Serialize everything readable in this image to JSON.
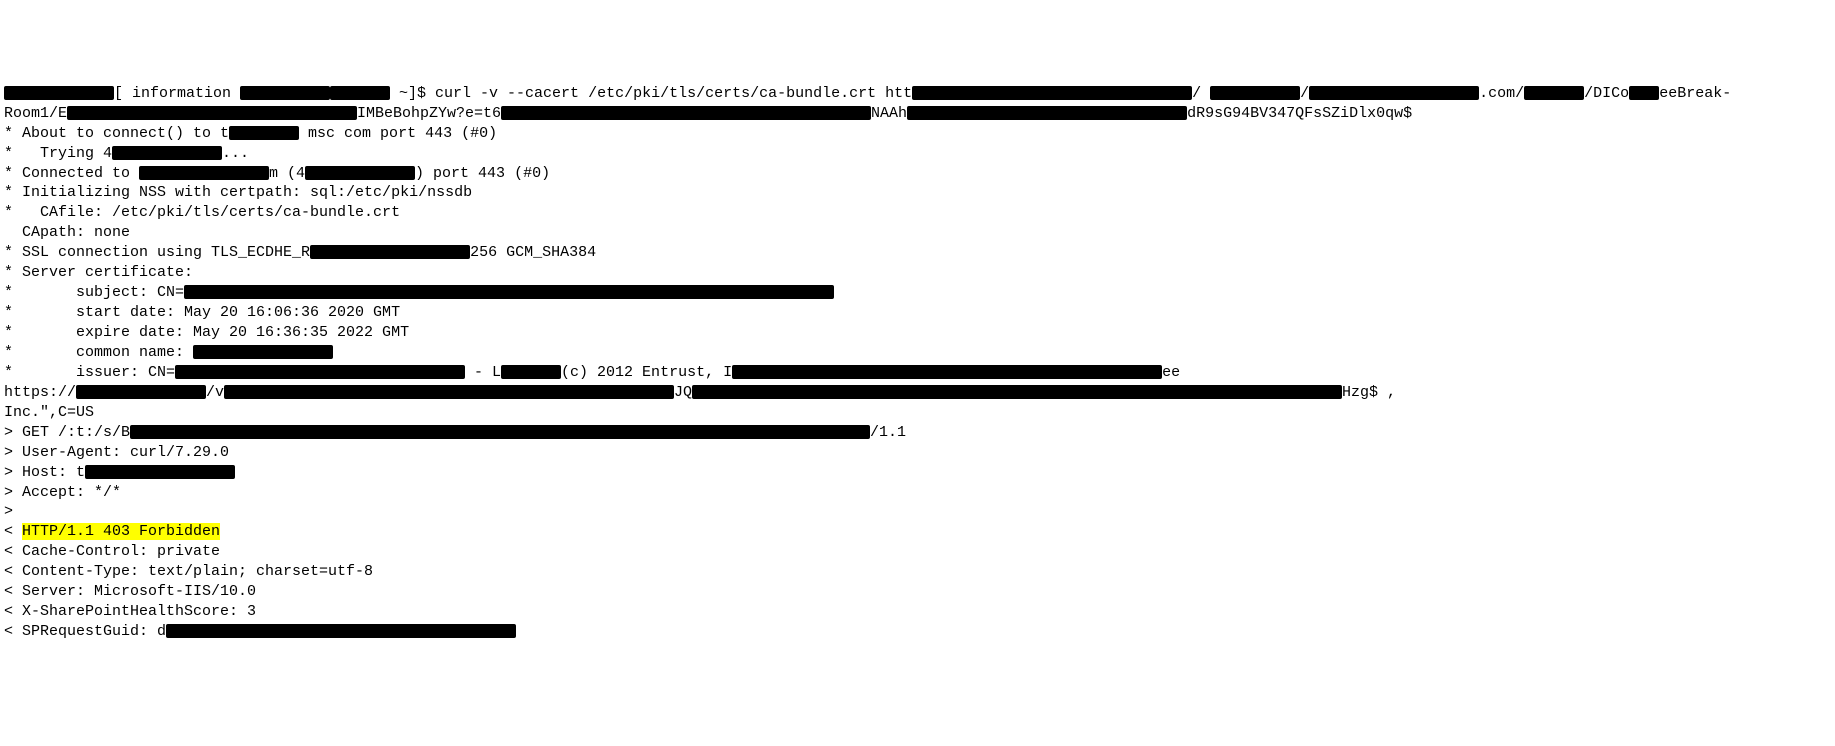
{
  "terminal": {
    "lines": [
      {
        "prefix": "",
        "redact1_w": 110,
        "text1": "[ information ",
        "redact2_w": 90,
        "text2": "",
        "redact3_w": 60,
        "text3": " ~]$ curl -v --cacert /etc/pki/tls/certs/ca-bundle.crt htt",
        "redact4_w": 280,
        "text4": "/ ",
        "redact5_w": 90,
        "text5": "/",
        "redact6_w": 170,
        "text6": ".com/",
        "redact7_w": 60,
        "text7": "/DICo",
        "redact8_w": 30,
        "text8": "eeBreak-"
      },
      {
        "prefix": "Room1/E",
        "redact1_w": 290,
        "text1": "IMBeBohpZYw?e=t6",
        "redact2_w": 370,
        "text2": "NAAh",
        "redact3_w": 280,
        "text3": "dR9sG94BV347QFsSZiDlx0qw$",
        "redact4_w": 0,
        "text4": "",
        "redact5_w": 0,
        "text5": "",
        "redact6_w": 0,
        "text6": "",
        "redact7_w": 0,
        "text7": "",
        "redact8_w": 0,
        "text8": ""
      },
      {
        "prefix": "* About to connect() to t",
        "redact1_w": 70,
        "text1": " msc com port 443 (#0)",
        "redact2_w": 0,
        "text2": "",
        "redact3_w": 0,
        "text3": "",
        "redact4_w": 0,
        "text4": "",
        "redact5_w": 0,
        "text5": "",
        "redact6_w": 0,
        "text6": "",
        "redact7_w": 0,
        "text7": "",
        "redact8_w": 0,
        "text8": ""
      },
      {
        "prefix": "*   Trying 4",
        "redact1_w": 110,
        "text1": "...",
        "redact2_w": 0,
        "text2": "",
        "redact3_w": 0,
        "text3": "",
        "redact4_w": 0,
        "text4": "",
        "redact5_w": 0,
        "text5": "",
        "redact6_w": 0,
        "text6": "",
        "redact7_w": 0,
        "text7": "",
        "redact8_w": 0,
        "text8": ""
      },
      {
        "prefix": "* Connected to ",
        "redact1_w": 130,
        "text1": "m (4",
        "redact2_w": 110,
        "text2": ") port 443 (#0)",
        "redact3_w": 0,
        "text3": "",
        "redact4_w": 0,
        "text4": "",
        "redact5_w": 0,
        "text5": "",
        "redact6_w": 0,
        "text6": "",
        "redact7_w": 0,
        "text7": "",
        "redact8_w": 0,
        "text8": ""
      },
      {
        "prefix": "* Initializing NSS with certpath: sql:/etc/pki/nssdb",
        "redact1_w": 0,
        "text1": "",
        "redact2_w": 0,
        "text2": "",
        "redact3_w": 0,
        "text3": "",
        "redact4_w": 0,
        "text4": "",
        "redact5_w": 0,
        "text5": "",
        "redact6_w": 0,
        "text6": "",
        "redact7_w": 0,
        "text7": "",
        "redact8_w": 0,
        "text8": ""
      },
      {
        "prefix": "*   CAfile: /etc/pki/tls/certs/ca-bundle.crt",
        "redact1_w": 0,
        "text1": "",
        "redact2_w": 0,
        "text2": "",
        "redact3_w": 0,
        "text3": "",
        "redact4_w": 0,
        "text4": "",
        "redact5_w": 0,
        "text5": "",
        "redact6_w": 0,
        "text6": "",
        "redact7_w": 0,
        "text7": "",
        "redact8_w": 0,
        "text8": ""
      },
      {
        "prefix": "  CApath: none",
        "redact1_w": 0,
        "text1": "",
        "redact2_w": 0,
        "text2": "",
        "redact3_w": 0,
        "text3": "",
        "redact4_w": 0,
        "text4": "",
        "redact5_w": 0,
        "text5": "",
        "redact6_w": 0,
        "text6": "",
        "redact7_w": 0,
        "text7": "",
        "redact8_w": 0,
        "text8": ""
      },
      {
        "prefix": "* SSL connection using TLS_ECDHE_R",
        "redact1_w": 160,
        "text1": "256 GCM_SHA384",
        "redact2_w": 0,
        "text2": "",
        "redact3_w": 0,
        "text3": "",
        "redact4_w": 0,
        "text4": "",
        "redact5_w": 0,
        "text5": "",
        "redact6_w": 0,
        "text6": "",
        "redact7_w": 0,
        "text7": "",
        "redact8_w": 0,
        "text8": ""
      },
      {
        "prefix": "* Server certificate:",
        "redact1_w": 0,
        "text1": "",
        "redact2_w": 0,
        "text2": "",
        "redact3_w": 0,
        "text3": "",
        "redact4_w": 0,
        "text4": "",
        "redact5_w": 0,
        "text5": "",
        "redact6_w": 0,
        "text6": "",
        "redact7_w": 0,
        "text7": "",
        "redact8_w": 0,
        "text8": ""
      },
      {
        "prefix": "*       subject: CN=",
        "redact1_w": 650,
        "text1": "",
        "redact2_w": 0,
        "text2": "",
        "redact3_w": 0,
        "text3": "",
        "redact4_w": 0,
        "text4": "",
        "redact5_w": 0,
        "text5": "",
        "redact6_w": 0,
        "text6": "",
        "redact7_w": 0,
        "text7": "",
        "redact8_w": 0,
        "text8": ""
      },
      {
        "prefix": "*       start date: May 20 16:06:36 2020 GMT",
        "redact1_w": 0,
        "text1": "",
        "redact2_w": 0,
        "text2": "",
        "redact3_w": 0,
        "text3": "",
        "redact4_w": 0,
        "text4": "",
        "redact5_w": 0,
        "text5": "",
        "redact6_w": 0,
        "text6": "",
        "redact7_w": 0,
        "text7": "",
        "redact8_w": 0,
        "text8": ""
      },
      {
        "prefix": "*       expire date: May 20 16:36:35 2022 GMT",
        "redact1_w": 0,
        "text1": "",
        "redact2_w": 0,
        "text2": "",
        "redact3_w": 0,
        "text3": "",
        "redact4_w": 0,
        "text4": "",
        "redact5_w": 0,
        "text5": "",
        "redact6_w": 0,
        "text6": "",
        "redact7_w": 0,
        "text7": "",
        "redact8_w": 0,
        "text8": ""
      },
      {
        "prefix": "*       common name: ",
        "redact1_w": 140,
        "text1": "",
        "redact2_w": 0,
        "text2": "",
        "redact3_w": 0,
        "text3": "",
        "redact4_w": 0,
        "text4": "",
        "redact5_w": 0,
        "text5": "",
        "redact6_w": 0,
        "text6": "",
        "redact7_w": 0,
        "text7": "",
        "redact8_w": 0,
        "text8": ""
      },
      {
        "prefix": "*       issuer: CN=",
        "redact1_w": 290,
        "text1": " - L",
        "redact2_w": 60,
        "text2": "(c) 2012 Entrust, I",
        "redact3_w": 430,
        "text3": "ee",
        "redact4_w": 0,
        "text4": "",
        "redact5_w": 0,
        "text5": "",
        "redact6_w": 0,
        "text6": "",
        "redact7_w": 0,
        "text7": "",
        "redact8_w": 0,
        "text8": ""
      },
      {
        "prefix": "https://",
        "redact1_w": 130,
        "text1": "/v",
        "redact2_w": 450,
        "text2": "JQ",
        "redact3_w": 650,
        "text3": "Hzg$ ,",
        "redact4_w": 0,
        "text4": "",
        "redact5_w": 0,
        "text5": "",
        "redact6_w": 0,
        "text6": "",
        "redact7_w": 0,
        "text7": "",
        "redact8_w": 0,
        "text8": ""
      },
      {
        "prefix": "Inc.\",C=US",
        "redact1_w": 0,
        "text1": "",
        "redact2_w": 0,
        "text2": "",
        "redact3_w": 0,
        "text3": "",
        "redact4_w": 0,
        "text4": "",
        "redact5_w": 0,
        "text5": "",
        "redact6_w": 0,
        "text6": "",
        "redact7_w": 0,
        "text7": "",
        "redact8_w": 0,
        "text8": ""
      },
      {
        "prefix": "> GET /:t:/s/B",
        "redact1_w": 740,
        "text1": "/1.1",
        "redact2_w": 0,
        "text2": "",
        "redact3_w": 0,
        "text3": "",
        "redact4_w": 0,
        "text4": "",
        "redact5_w": 0,
        "text5": "",
        "redact6_w": 0,
        "text6": "",
        "redact7_w": 0,
        "text7": "",
        "redact8_w": 0,
        "text8": ""
      },
      {
        "prefix": "> User-Agent: curl/7.29.0",
        "redact1_w": 0,
        "text1": "",
        "redact2_w": 0,
        "text2": "",
        "redact3_w": 0,
        "text3": "",
        "redact4_w": 0,
        "text4": "",
        "redact5_w": 0,
        "text5": "",
        "redact6_w": 0,
        "text6": "",
        "redact7_w": 0,
        "text7": "",
        "redact8_w": 0,
        "text8": ""
      },
      {
        "prefix": "> Host: t",
        "redact1_w": 150,
        "text1": "",
        "redact2_w": 0,
        "text2": "",
        "redact3_w": 0,
        "text3": "",
        "redact4_w": 0,
        "text4": "",
        "redact5_w": 0,
        "text5": "",
        "redact6_w": 0,
        "text6": "",
        "redact7_w": 0,
        "text7": "",
        "redact8_w": 0,
        "text8": ""
      },
      {
        "prefix": "> Accept: */*",
        "redact1_w": 0,
        "text1": "",
        "redact2_w": 0,
        "text2": "",
        "redact3_w": 0,
        "text3": "",
        "redact4_w": 0,
        "text4": "",
        "redact5_w": 0,
        "text5": "",
        "redact6_w": 0,
        "text6": "",
        "redact7_w": 0,
        "text7": "",
        "redact8_w": 0,
        "text8": ""
      },
      {
        "prefix": ">",
        "redact1_w": 0,
        "text1": "",
        "redact2_w": 0,
        "text2": "",
        "redact3_w": 0,
        "text3": "",
        "redact4_w": 0,
        "text4": "",
        "redact5_w": 0,
        "text5": "",
        "redact6_w": 0,
        "text6": "",
        "redact7_w": 0,
        "text7": "",
        "redact8_w": 0,
        "text8": ""
      },
      {
        "prefix": "< ",
        "highlight": "HTTP/1.1 403 Forbidden",
        "redact1_w": 0,
        "text1": "",
        "redact2_w": 0,
        "text2": "",
        "redact3_w": 0,
        "text3": "",
        "redact4_w": 0,
        "text4": "",
        "redact5_w": 0,
        "text5": "",
        "redact6_w": 0,
        "text6": "",
        "redact7_w": 0,
        "text7": "",
        "redact8_w": 0,
        "text8": ""
      },
      {
        "prefix": "< Cache-Control: private",
        "redact1_w": 0,
        "text1": "",
        "redact2_w": 0,
        "text2": "",
        "redact3_w": 0,
        "text3": "",
        "redact4_w": 0,
        "text4": "",
        "redact5_w": 0,
        "text5": "",
        "redact6_w": 0,
        "text6": "",
        "redact7_w": 0,
        "text7": "",
        "redact8_w": 0,
        "text8": ""
      },
      {
        "prefix": "< Content-Type: text/plain; charset=utf-8",
        "redact1_w": 0,
        "text1": "",
        "redact2_w": 0,
        "text2": "",
        "redact3_w": 0,
        "text3": "",
        "redact4_w": 0,
        "text4": "",
        "redact5_w": 0,
        "text5": "",
        "redact6_w": 0,
        "text6": "",
        "redact7_w": 0,
        "text7": "",
        "redact8_w": 0,
        "text8": ""
      },
      {
        "prefix": "< Server: Microsoft-IIS/10.0",
        "redact1_w": 0,
        "text1": "",
        "redact2_w": 0,
        "text2": "",
        "redact3_w": 0,
        "text3": "",
        "redact4_w": 0,
        "text4": "",
        "redact5_w": 0,
        "text5": "",
        "redact6_w": 0,
        "text6": "",
        "redact7_w": 0,
        "text7": "",
        "redact8_w": 0,
        "text8": ""
      },
      {
        "prefix": "< X-SharePointHealthScore: 3",
        "redact1_w": 0,
        "text1": "",
        "redact2_w": 0,
        "text2": "",
        "redact3_w": 0,
        "text3": "",
        "redact4_w": 0,
        "text4": "",
        "redact5_w": 0,
        "text5": "",
        "redact6_w": 0,
        "text6": "",
        "redact7_w": 0,
        "text7": "",
        "redact8_w": 0,
        "text8": ""
      },
      {
        "prefix": "< SPRequestGuid: d",
        "redact1_w": 350,
        "text1": "",
        "redact2_w": 0,
        "text2": "",
        "redact3_w": 0,
        "text3": "",
        "redact4_w": 0,
        "text4": "",
        "redact5_w": 0,
        "text5": "",
        "redact6_w": 0,
        "text6": "",
        "redact7_w": 0,
        "text7": "",
        "redact8_w": 0,
        "text8": ""
      }
    ]
  }
}
